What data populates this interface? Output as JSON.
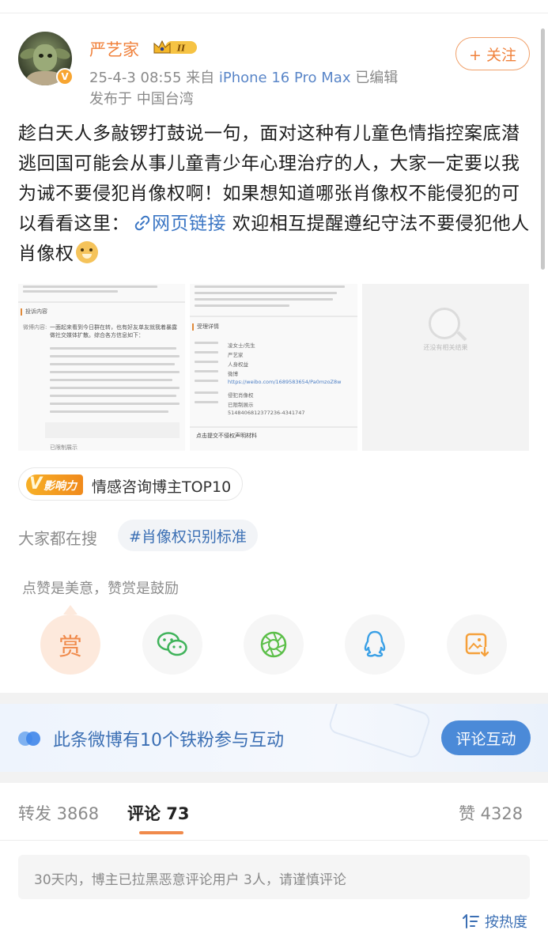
{
  "author": {
    "name": "严艺家",
    "verified_badge": "V",
    "level_badge": "II",
    "timestamp": "25-4-3 08:55",
    "source_prefix": "来自",
    "device": "iPhone 16 Pro Max",
    "edited": "已编辑",
    "location": "发布于 中国台湾",
    "follow_label": "+ 关注"
  },
  "post": {
    "text_before_link": "趁白天人多敲锣打鼓说一句，面对这种有儿童色情指控案底潜逃回国可能会从事儿童青少年心理治疗的人，大家一定要以我为诫不要侵犯肖像权啊！如果想知道哪张肖像权不能侵犯的可以看看这里：",
    "link_label": "网页链接",
    "text_after_link": " 欢迎相互提醒遵纪守法不要侵犯他人肖像权",
    "emoji": "doge"
  },
  "images": {
    "img1": {
      "head_text": "投诉内容",
      "label": "微博内容:",
      "body": "一面起来看到今日群在转，也有好友单友就我着暴露做社交媒体扩散。综合各方信息如下：",
      "footer": "已限制展示"
    },
    "img2": {
      "head_text": "受理详情",
      "rows": [
        "凌女士/先生",
        "严艺家",
        "人身权益",
        "微博",
        "https://weibo.com/1689583654/Pa0mzoZ8w",
        "侵犯肖像权",
        "已限制展示",
        "5148406812377236-4341747"
      ],
      "footer": "点击提交不侵权声明材料"
    },
    "img3": {
      "empty_text": "还没有相关结果"
    }
  },
  "influence": {
    "logo_v": "V",
    "logo_text": "影响力",
    "label": "情感咨询博主TOP10"
  },
  "trending": {
    "label": "大家都在搜",
    "chip": "#肖像权识别标准"
  },
  "reward": {
    "text": "点赞是美意，赞赏是鼓励",
    "reward_glyph": "赏"
  },
  "share_icons": [
    "reward-icon",
    "wechat-icon",
    "moments-icon",
    "qq-icon",
    "save-image-icon"
  ],
  "fans": {
    "text": "此条微博有10个铁粉参与互动",
    "button": "评论互动"
  },
  "tabs": {
    "repost": "转发 3868",
    "comment": "评论 73",
    "like": "赞 4328"
  },
  "notice": "30天内，博主已拉黑恶意评论用户 3人，请谨慎评论",
  "sort_label": "按热度",
  "colors": {
    "accent_orange": "#f0813b",
    "link_blue": "#3b76c4",
    "button_blue": "#4b8ad8"
  }
}
